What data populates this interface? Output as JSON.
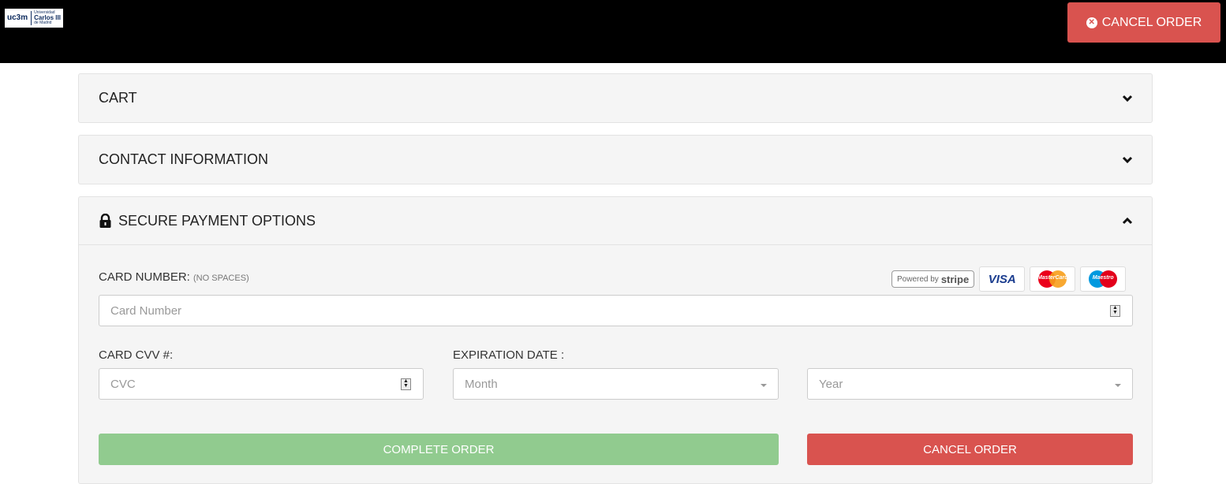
{
  "logo": {
    "main": "uc3m",
    "line1": "Universidad",
    "line2": "Carlos III",
    "line3": "de Madrid"
  },
  "header": {
    "cancel_label": "CANCEL ORDER"
  },
  "panels": {
    "cart": {
      "title": "CART"
    },
    "contact": {
      "title": "CONTACT INFORMATION"
    },
    "payment": {
      "title": "SECURE PAYMENT OPTIONS"
    }
  },
  "payment": {
    "card_number_label": "CARD NUMBER:",
    "card_number_hint": "(NO SPACES)",
    "card_number_placeholder": "Card Number",
    "cvv_label": "CARD CVV #:",
    "cvv_placeholder": "CVC",
    "expiration_label": "EXPIRATION DATE :",
    "month_placeholder": "Month",
    "year_placeholder": "Year",
    "stripe_powered": "Powered by",
    "stripe_brand": "stripe",
    "card_brands": [
      "VISA",
      "MasterCard",
      "Maestro"
    ],
    "complete_label": "COMPLETE ORDER",
    "cancel_label": "CANCEL ORDER"
  },
  "colors": {
    "topbar": "#000000",
    "danger": "#d9534f",
    "success_disabled": "#91cb8f",
    "panel_bg": "#f5f5f5"
  },
  "icons": {
    "cancel": "times-circle-icon",
    "collapse": "chevron-down-icon",
    "expand": "chevron-up-icon",
    "secure": "lock-icon"
  }
}
